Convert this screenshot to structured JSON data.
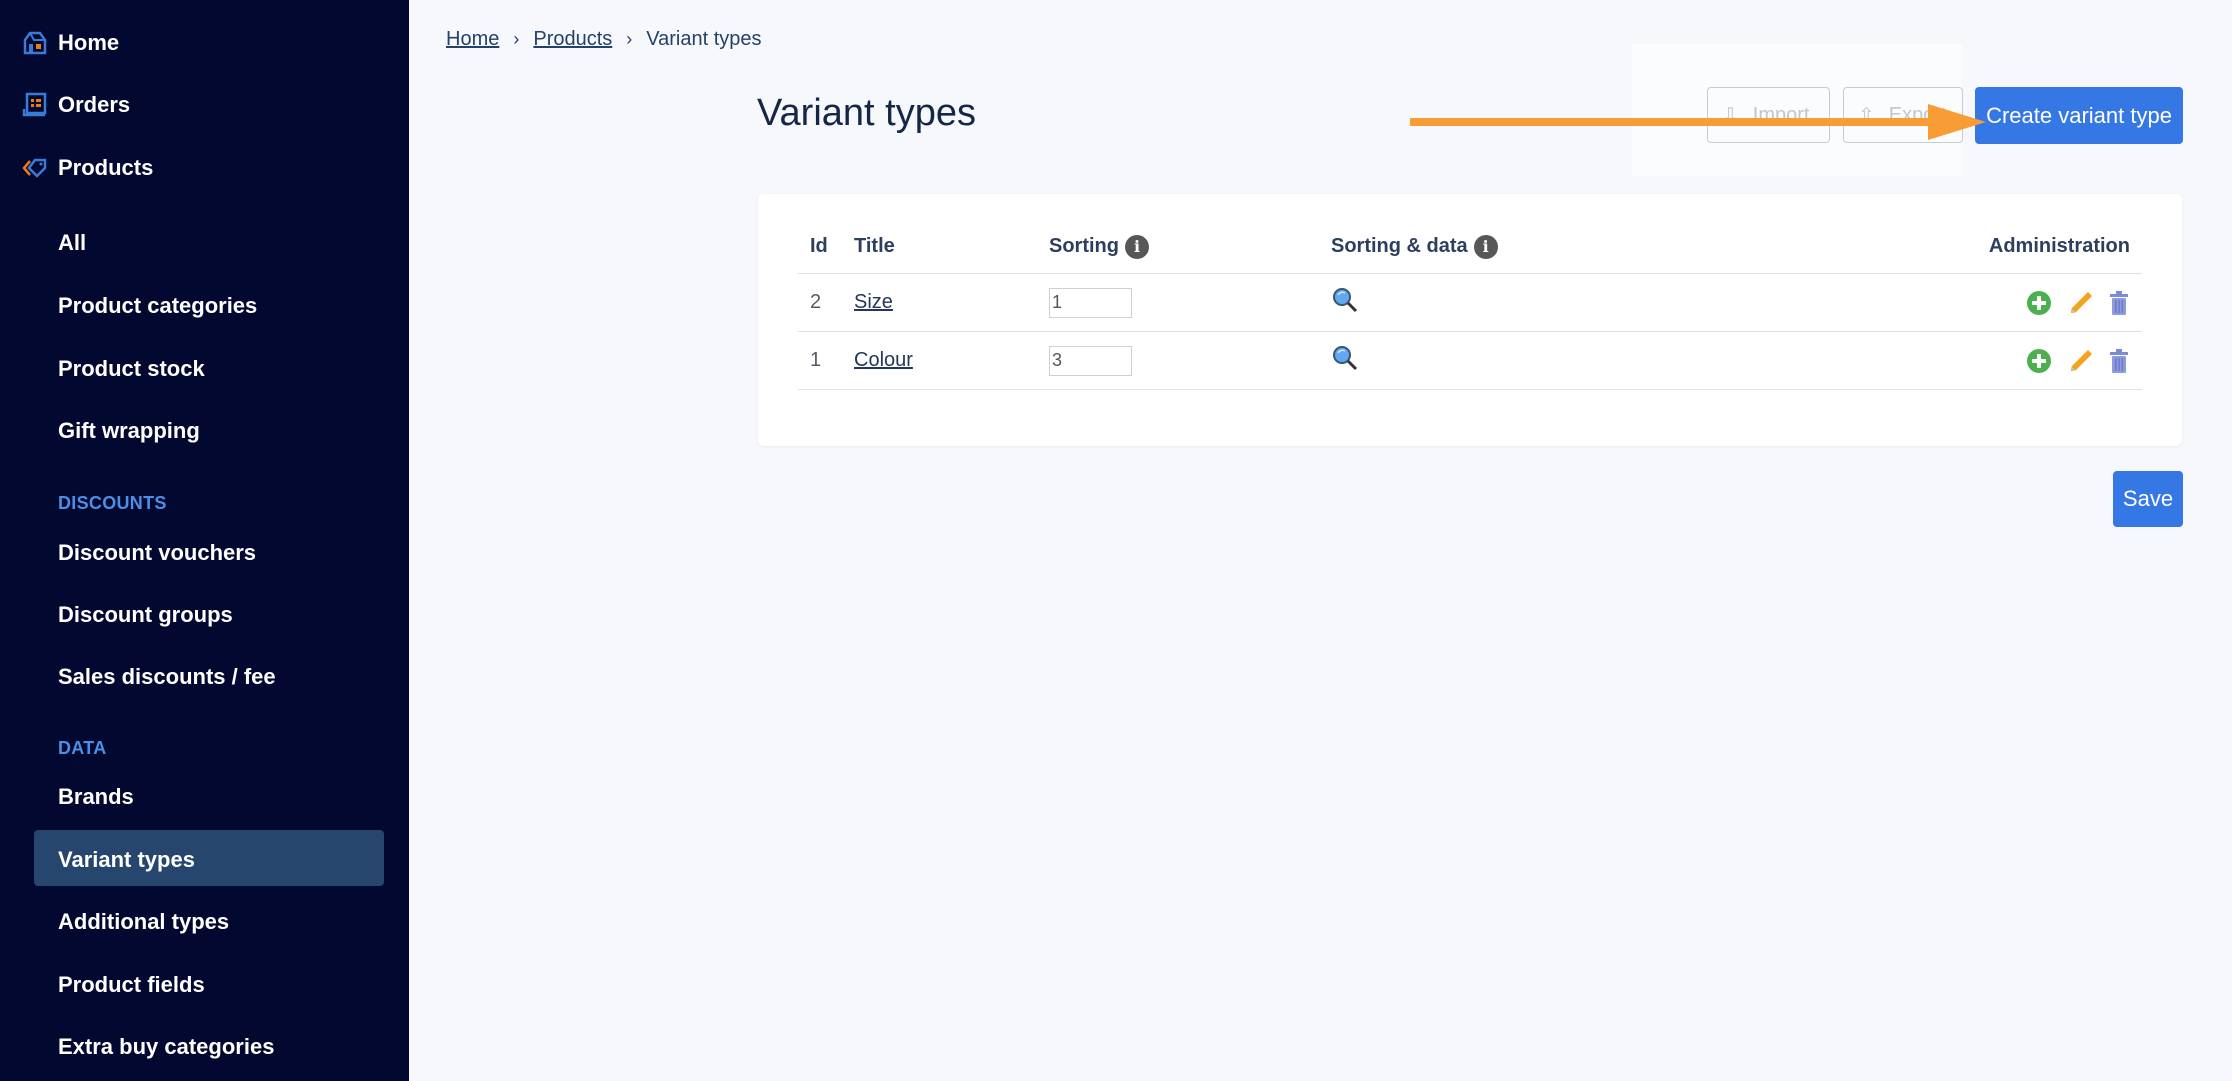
{
  "sidebar": {
    "top_items": [
      {
        "label": "Home",
        "icon": "home-icon"
      },
      {
        "label": "Orders",
        "icon": "orders-icon"
      },
      {
        "label": "Products",
        "icon": "tag-icon"
      }
    ],
    "product_items": [
      "All",
      "Product categories",
      "Product stock",
      "Gift wrapping"
    ],
    "sections": [
      {
        "label": "DISCOUNTS",
        "items": [
          "Discount vouchers",
          "Discount groups",
          "Sales discounts / fee"
        ]
      },
      {
        "label": "DATA",
        "items": [
          "Brands",
          "Variant types",
          "Additional types",
          "Product fields",
          "Extra buy categories"
        ]
      }
    ],
    "active_item": "Variant types"
  },
  "breadcrumb": [
    "Home",
    "Products",
    "Variant types"
  ],
  "page": {
    "title": "Variant types",
    "import_label": "Import",
    "export_label": "Export",
    "create_label": "Create variant type",
    "save_label": "Save"
  },
  "table": {
    "columns": [
      "Id",
      "Title",
      "Sorting",
      "Sorting & data",
      "Administration"
    ],
    "rows": [
      {
        "id": "2",
        "title": "Size",
        "sorting": "1"
      },
      {
        "id": "1",
        "title": "Colour",
        "sorting": "3"
      }
    ]
  },
  "colors": {
    "sidebar_bg": "#030830",
    "sidebar_active": "#26466e",
    "primary": "#3578e5",
    "annotation_arrow": "#f89c35",
    "add_green": "#4caf50",
    "edit_orange": "#f7a21b",
    "delete_blue": "#7d8bd6"
  }
}
